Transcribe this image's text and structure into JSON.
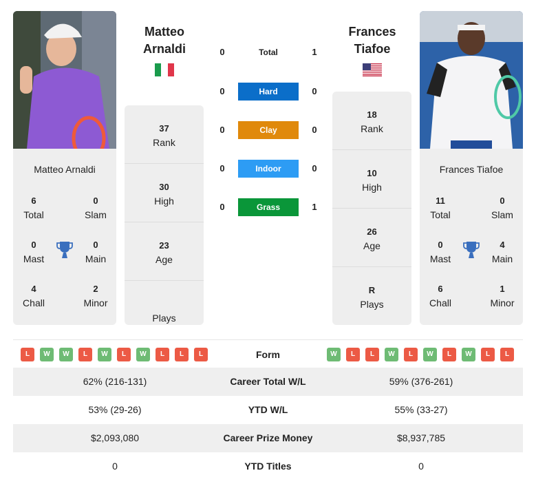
{
  "colors": {
    "hard": "#0b6ec9",
    "clay": "#e0890b",
    "indoor": "#2d9cf4",
    "grass": "#0a9639",
    "win": "#6ebb74",
    "loss": "#ec5a45",
    "trophy": "#3a6fbe"
  },
  "player1": {
    "name_line1": "Matteo",
    "name_line2": "Arnaldi",
    "full_name": "Matteo Arnaldi",
    "country_flag": "italy-flag",
    "titles": {
      "total": {
        "value": "6",
        "label": "Total"
      },
      "slam": {
        "value": "0",
        "label": "Slam"
      },
      "mast": {
        "value": "0",
        "label": "Mast"
      },
      "main": {
        "value": "0",
        "label": "Main"
      },
      "chall": {
        "value": "4",
        "label": "Chall"
      },
      "minor": {
        "value": "2",
        "label": "Minor"
      }
    },
    "stats": [
      {
        "value": "37",
        "label": "Rank"
      },
      {
        "value": "30",
        "label": "High"
      },
      {
        "value": "23",
        "label": "Age"
      },
      {
        "value": "",
        "label": "Plays"
      }
    ],
    "form": [
      "L",
      "W",
      "W",
      "L",
      "W",
      "L",
      "W",
      "L",
      "L",
      "L"
    ]
  },
  "player2": {
    "name_line1": "Frances",
    "name_line2": "Tiafoe",
    "full_name": "Frances Tiafoe",
    "country_flag": "usa-flag",
    "titles": {
      "total": {
        "value": "11",
        "label": "Total"
      },
      "slam": {
        "value": "0",
        "label": "Slam"
      },
      "mast": {
        "value": "0",
        "label": "Mast"
      },
      "main": {
        "value": "4",
        "label": "Main"
      },
      "chall": {
        "value": "6",
        "label": "Chall"
      },
      "minor": {
        "value": "1",
        "label": "Minor"
      }
    },
    "stats": [
      {
        "value": "18",
        "label": "Rank"
      },
      {
        "value": "10",
        "label": "High"
      },
      {
        "value": "26",
        "label": "Age"
      },
      {
        "value": "R",
        "label": "Plays"
      }
    ],
    "form": [
      "W",
      "L",
      "L",
      "W",
      "L",
      "W",
      "L",
      "W",
      "L",
      "L"
    ]
  },
  "h2h": [
    {
      "label": "Total",
      "left": "0",
      "right": "1"
    },
    {
      "label": "Hard",
      "left": "0",
      "right": "0"
    },
    {
      "label": "Clay",
      "left": "0",
      "right": "0"
    },
    {
      "label": "Indoor",
      "left": "0",
      "right": "0"
    },
    {
      "label": "Grass",
      "left": "0",
      "right": "1"
    }
  ],
  "comparison": {
    "form_label": "Form",
    "rows": [
      {
        "label": "Career Total W/L",
        "left": "62% (216-131)",
        "right": "59% (376-261)"
      },
      {
        "label": "YTD W/L",
        "left": "53% (29-26)",
        "right": "55% (33-27)"
      },
      {
        "label": "Career Prize Money",
        "left": "$2,093,080",
        "right": "$8,937,785"
      },
      {
        "label": "YTD Titles",
        "left": "0",
        "right": "0"
      }
    ]
  }
}
